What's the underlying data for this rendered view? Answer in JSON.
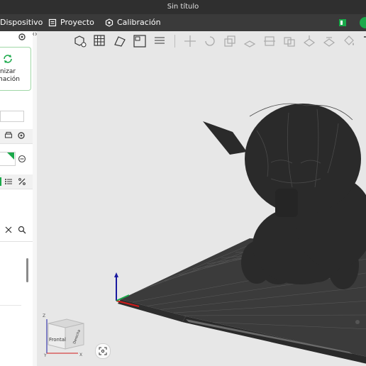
{
  "window": {
    "title": "Sin título"
  },
  "menu": {
    "items": [
      {
        "label": "Dispositivo"
      },
      {
        "label": "Proyecto"
      },
      {
        "label": "Calibración"
      }
    ]
  },
  "left_panel": {
    "sync_lines": [
      "cronizar",
      "ormación"
    ]
  },
  "viewcube": {
    "front_label": "Frontal",
    "right_label": "Derecha",
    "axis_z": "Z",
    "axis_y": "Y",
    "axis_x": "X"
  },
  "colors": {
    "accent": "#1aa94a",
    "titlebar": "#2f2f2f",
    "menubar": "#3a3a3a",
    "viewport": "#e7e7e7",
    "model": "#2a2a2a",
    "plate": "#3b3b3b"
  }
}
